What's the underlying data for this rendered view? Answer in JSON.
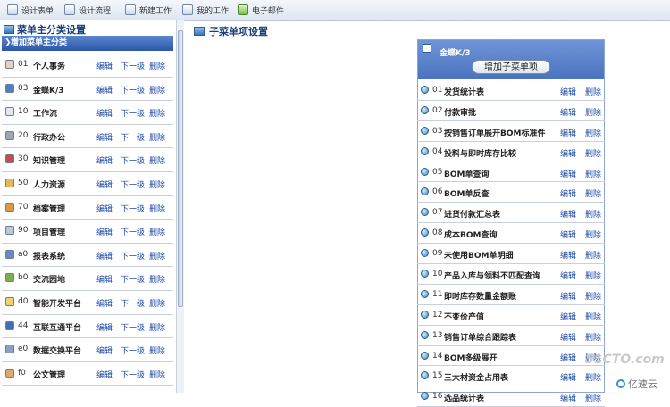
{
  "toolbar": {
    "items": [
      {
        "label": "设计表单"
      },
      {
        "label": "设计流程"
      },
      {
        "label": "新建工作"
      },
      {
        "label": "我的工作"
      },
      {
        "label": "电子邮件"
      }
    ]
  },
  "left": {
    "title": "菜单主分类设置",
    "add_label": "增加菜单主分类",
    "link_edit": "编辑",
    "link_next": "下一级",
    "link_delete": "删除",
    "items": [
      {
        "code": "01",
        "name": "个人事务",
        "icon_color": "#e4d3b8",
        "icon": "person-icon"
      },
      {
        "code": "03",
        "name": "金蝶K/3",
        "icon_color": "#4f7fc1",
        "icon": "k3-icon"
      },
      {
        "code": "10",
        "name": "工作流",
        "icon_color": "#dfe9f6",
        "icon": "workflow-icon"
      },
      {
        "code": "20",
        "name": "行政办公",
        "icon_color": "#9ea6b3",
        "icon": "office-icon"
      },
      {
        "code": "30",
        "name": "知识管理",
        "icon_color": "#c94a4a",
        "icon": "knowledge-icon"
      },
      {
        "code": "50",
        "name": "人力资源",
        "icon_color": "#e9b55a",
        "icon": "hr-icon"
      },
      {
        "code": "70",
        "name": "档案管理",
        "icon_color": "#d79c4a",
        "icon": "archive-icon"
      },
      {
        "code": "90",
        "name": "项目管理",
        "icon_color": "#c0c7d2",
        "icon": "project-icon"
      },
      {
        "code": "a0",
        "name": "报表系统",
        "icon_color": "#6b8ac2",
        "icon": "report-icon"
      },
      {
        "code": "b0",
        "name": "交流园地",
        "icon_color": "#79b04a",
        "icon": "community-icon"
      },
      {
        "code": "d0",
        "name": "智能开发平台",
        "icon_color": "#f0d070",
        "icon": "dev-platform-icon"
      },
      {
        "code": "44",
        "name": "互联互通平台",
        "icon_color": "#3f6fb4",
        "icon": "interconnect-icon"
      },
      {
        "code": "e0",
        "name": "数据交换平台",
        "icon_color": "#8aa0c4",
        "icon": "data-exchange-icon"
      },
      {
        "code": "f0",
        "name": "公文管理",
        "icon_color": "#e2a86a",
        "icon": "document-icon"
      }
    ]
  },
  "sub": {
    "title": "子菜单项设置",
    "parent_name": "金蝶K/3",
    "add_button": "增加子菜单项",
    "link_edit": "编辑",
    "link_delete": "删除",
    "items": [
      {
        "code": "01",
        "name": "发货统计表"
      },
      {
        "code": "02",
        "name": "付款审批"
      },
      {
        "code": "03",
        "name": "按销售订单展开BOM标准件"
      },
      {
        "code": "04",
        "name": "投料与即时库存比较"
      },
      {
        "code": "05",
        "name": "BOM单查询"
      },
      {
        "code": "06",
        "name": "BOM单反查"
      },
      {
        "code": "07",
        "name": "进货付款汇总表"
      },
      {
        "code": "08",
        "name": "成本BOM查询"
      },
      {
        "code": "09",
        "name": "未使用BOM单明细"
      },
      {
        "code": "10",
        "name": "产品入库与领料不匹配查询"
      },
      {
        "code": "11",
        "name": "即时库存数量金额账"
      },
      {
        "code": "12",
        "name": "不变价产值"
      },
      {
        "code": "13",
        "name": "销售订单综合跟踪表"
      },
      {
        "code": "14",
        "name": "BOM多级展开"
      },
      {
        "code": "15",
        "name": "三大材资金占用表"
      },
      {
        "code": "16",
        "name": "选品统计表"
      }
    ]
  },
  "watermark": {
    "text1": "51CTO.com",
    "text2": "亿速云"
  }
}
